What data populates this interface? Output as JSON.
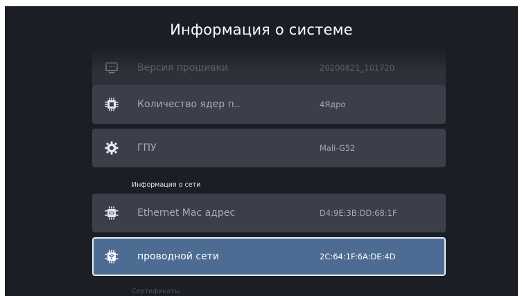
{
  "page": {
    "title": "Информация о системе"
  },
  "rows": [
    {
      "label": "Версия прошивки",
      "value": "20200821_101720",
      "icon": "tv-icon"
    },
    {
      "label": "Количество ядер п..",
      "value": "4Ядро",
      "icon": "cpu-icon"
    },
    {
      "label": "ГПУ",
      "value": "Mali-G52",
      "icon": "gpu-icon"
    }
  ],
  "sections": {
    "network": "Информация о сети",
    "certificates": "Сертификаты"
  },
  "network_rows": [
    {
      "label": "Ethernet Mac адрес",
      "value": "D4:9E:3B:DD:68:1F",
      "icon": "ethernet-icon"
    },
    {
      "label": "проводной сети",
      "value": "2C:64:1F:6A:DE:4D",
      "icon": "wifi-chip-icon"
    }
  ],
  "colors": {
    "background": "#1b1e24",
    "row": "#3a3f4a",
    "selected": "#4d6c94"
  }
}
